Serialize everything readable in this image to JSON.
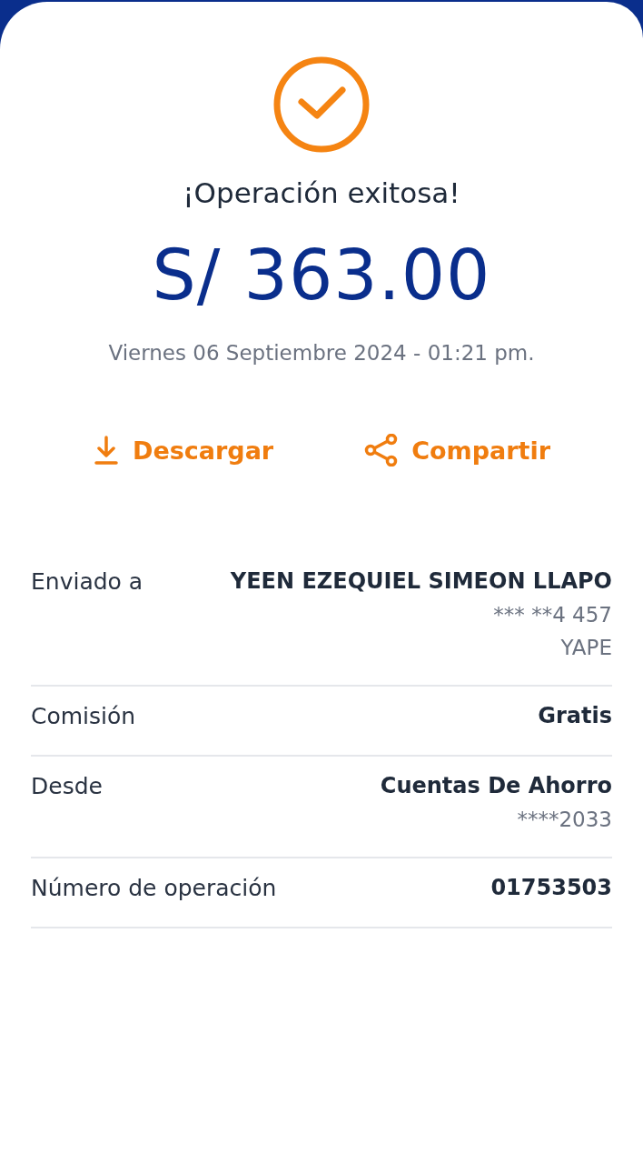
{
  "status": {
    "title": "¡Operación exitosa!",
    "amount": "S/ 363.00",
    "date": "Viernes 06 Septiembre 2024 - 01:21 pm."
  },
  "actions": [
    {
      "kind": "download",
      "label": "Descargar"
    },
    {
      "kind": "share",
      "label": "Compartir"
    }
  ],
  "details": [
    {
      "label": "Enviado a",
      "lines": [
        {
          "text": "YEEN EZEQUIEL SIMEON LLAPO",
          "emphasis": true
        },
        {
          "text": "*** **4 457",
          "emphasis": false
        },
        {
          "text": "YAPE",
          "emphasis": false
        }
      ]
    },
    {
      "label": "Comisión",
      "lines": [
        {
          "text": "Gratis",
          "emphasis": true
        }
      ]
    },
    {
      "label": "Desde",
      "lines": [
        {
          "text": "Cuentas De Ahorro",
          "emphasis": true
        },
        {
          "text": "****2033",
          "emphasis": false
        }
      ]
    },
    {
      "label": "Número de operación",
      "lines": [
        {
          "text": "01753503",
          "emphasis": true
        }
      ]
    }
  ]
}
